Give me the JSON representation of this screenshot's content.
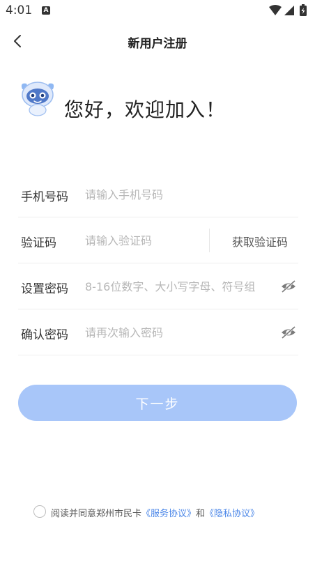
{
  "status": {
    "time": "4:01",
    "notification_badge": "A"
  },
  "nav": {
    "title": "新用户注册"
  },
  "welcome": {
    "greeting": "您好，欢迎加入！"
  },
  "form": {
    "phone": {
      "label": "手机号码",
      "placeholder": "请输入手机号码"
    },
    "code": {
      "label": "验证码",
      "placeholder": "请输入验证码",
      "get_code_label": "获取验证码"
    },
    "password": {
      "label": "设置密码",
      "placeholder": "8-16位数字、大小写字母、符号组"
    },
    "confirm": {
      "label": "确认密码",
      "placeholder": "请再次输入密码"
    }
  },
  "next_button": {
    "label": "下一步",
    "color": "#a8c6f9"
  },
  "agreement": {
    "prefix": "阅读并同意郑州市民卡",
    "service_link": "《服务协议》",
    "and": "和",
    "privacy_link": "《隐私协议》",
    "link_color": "#4a86e8"
  },
  "icons": [
    "back-chevron",
    "mascot",
    "eye-off",
    "wifi",
    "signal",
    "battery-charging"
  ]
}
